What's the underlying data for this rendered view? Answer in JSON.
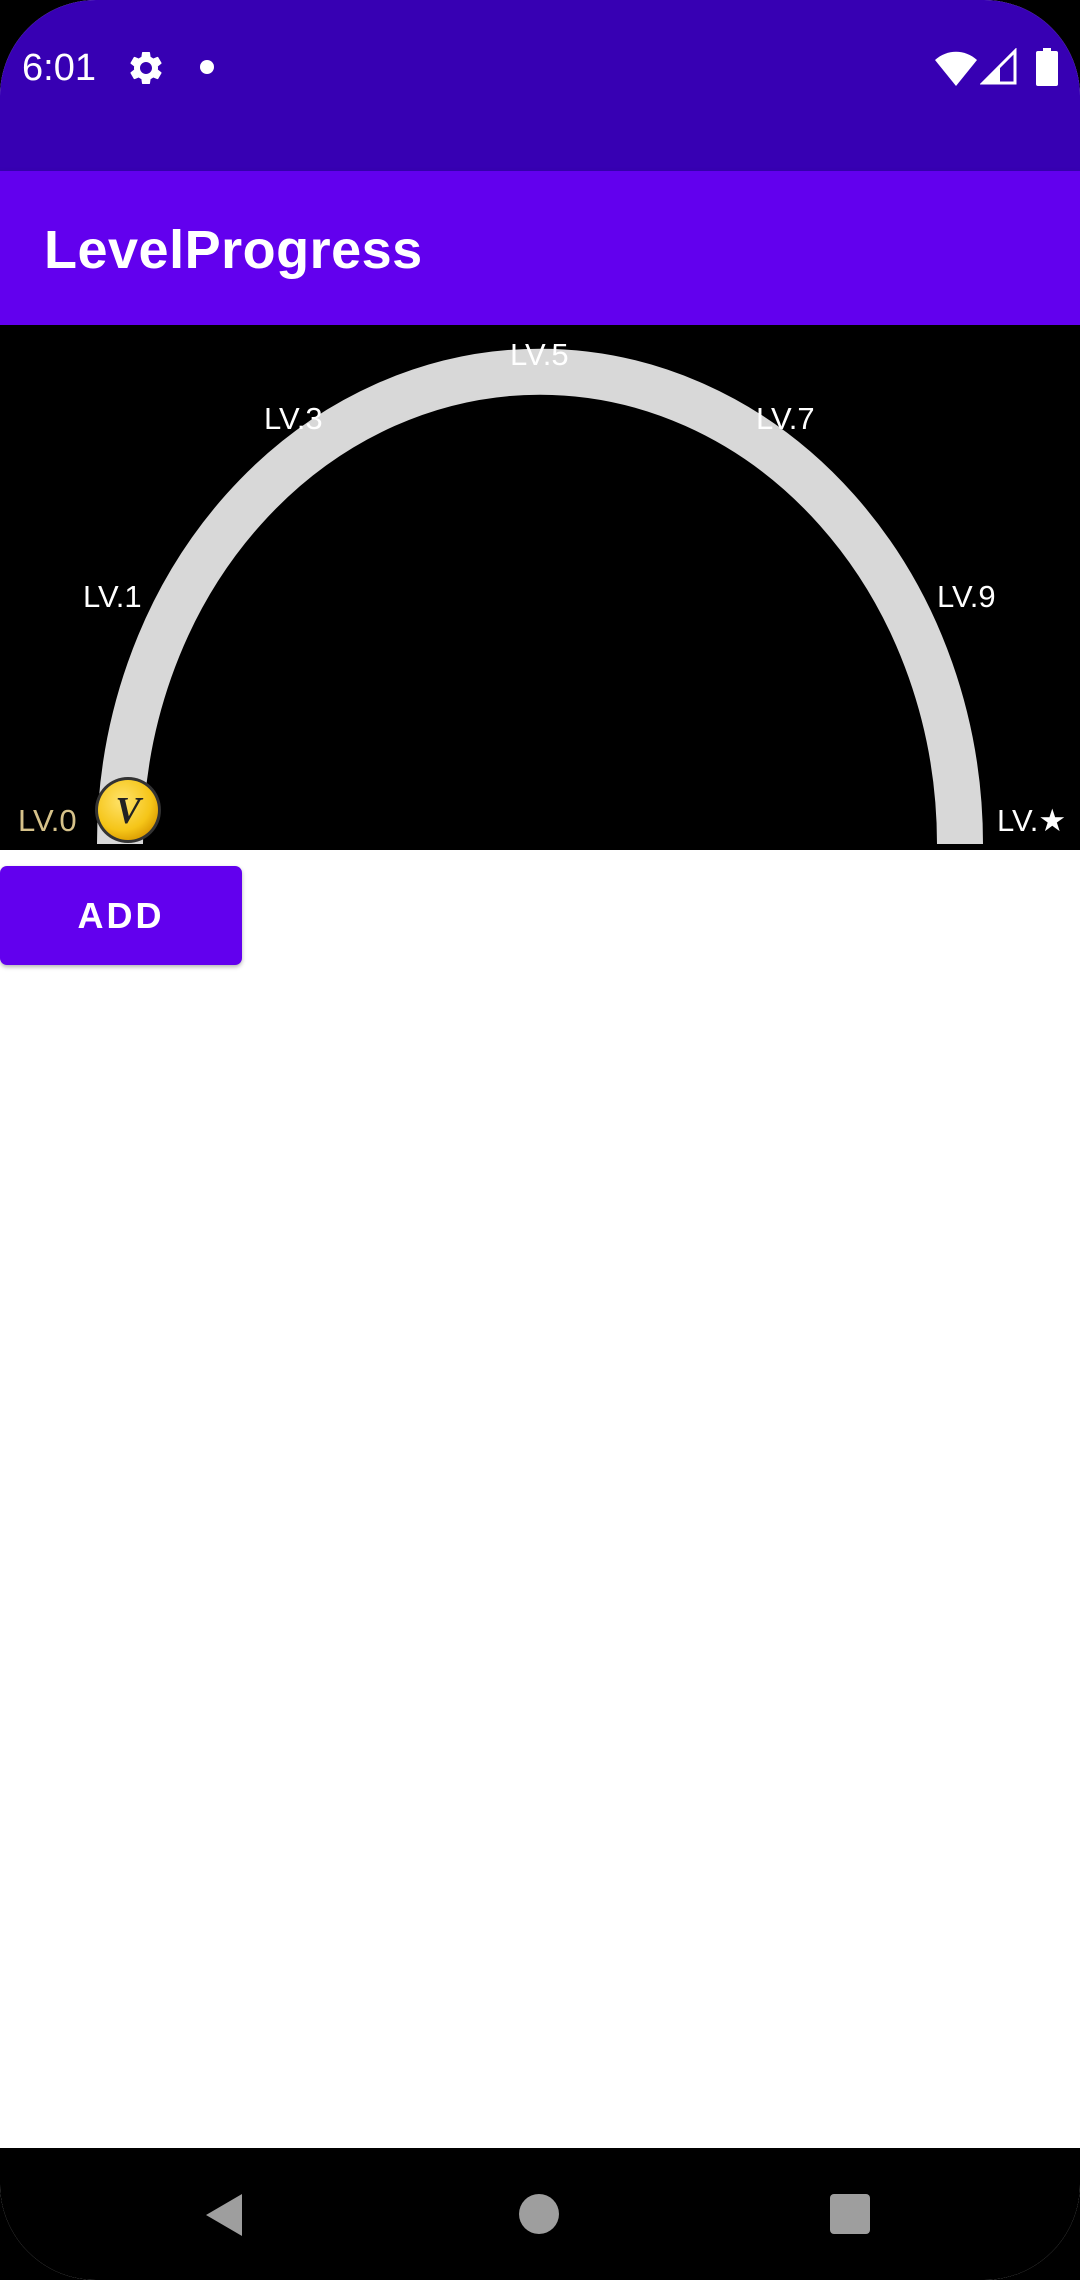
{
  "status_bar": {
    "time": "6:01",
    "icons": [
      "gear-icon",
      "notification-dot-icon",
      "wifi-icon",
      "cell-signal-icon",
      "battery-icon"
    ]
  },
  "app_bar": {
    "title": "LevelProgress"
  },
  "level_progress": {
    "labels": {
      "lv0": "LV.0",
      "lv1": "LV.1",
      "lv3": "LV.3",
      "lv5": "LV.5",
      "lv7": "LV.7",
      "lv9": "LV.9",
      "lv_star": "LV.★"
    },
    "current_level": "LV.0",
    "progress_fraction": 0,
    "coin_letter": "V",
    "colors": {
      "background": "#000000",
      "track": "#d8d8d8",
      "label": "#ffffff",
      "current_label": "#d6c28a",
      "coin_gold": "#f5c518"
    }
  },
  "actions": {
    "add_label": "ADD"
  },
  "nav_bar": {
    "icons": [
      "back-icon",
      "home-icon",
      "recents-icon"
    ]
  },
  "colors": {
    "status_bar": "#3700b3",
    "primary": "#6200ee",
    "on_primary": "#ffffff"
  }
}
